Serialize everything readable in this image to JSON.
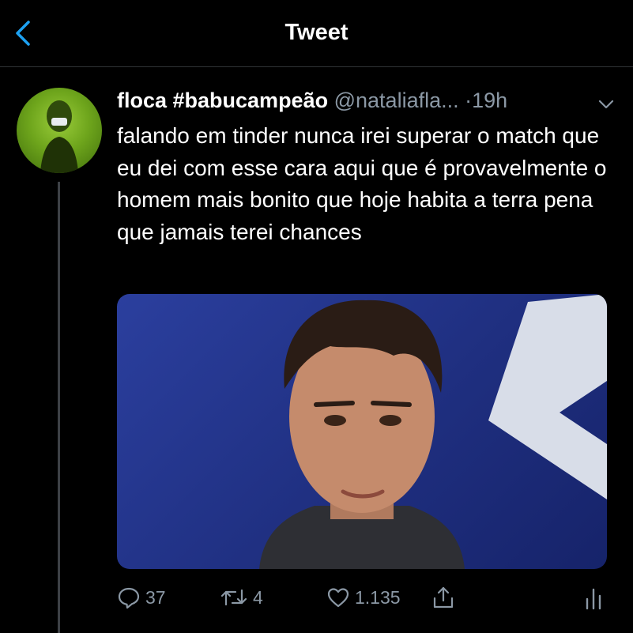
{
  "header": {
    "title": "Tweet"
  },
  "tweet": {
    "display_name": "floca #babucampeão",
    "handle": "@nataliafla...",
    "separator": "·",
    "time": "19h",
    "text": "falando em tinder nunca irei superar o match que eu dei com esse cara aqui que é provavelmente o homem mais bonito que hoje habita a terra pena que jamais terei chances",
    "actions": {
      "replies": "37",
      "retweets": "4",
      "likes": "1.135"
    }
  },
  "icons": [
    "back-icon",
    "chevron-down-icon",
    "reply-icon",
    "retweet-icon",
    "like-icon",
    "share-icon",
    "analytics-icon"
  ],
  "colors": {
    "background": "#000000",
    "accent": "#1da1f2",
    "muted": "#8b98a5"
  }
}
